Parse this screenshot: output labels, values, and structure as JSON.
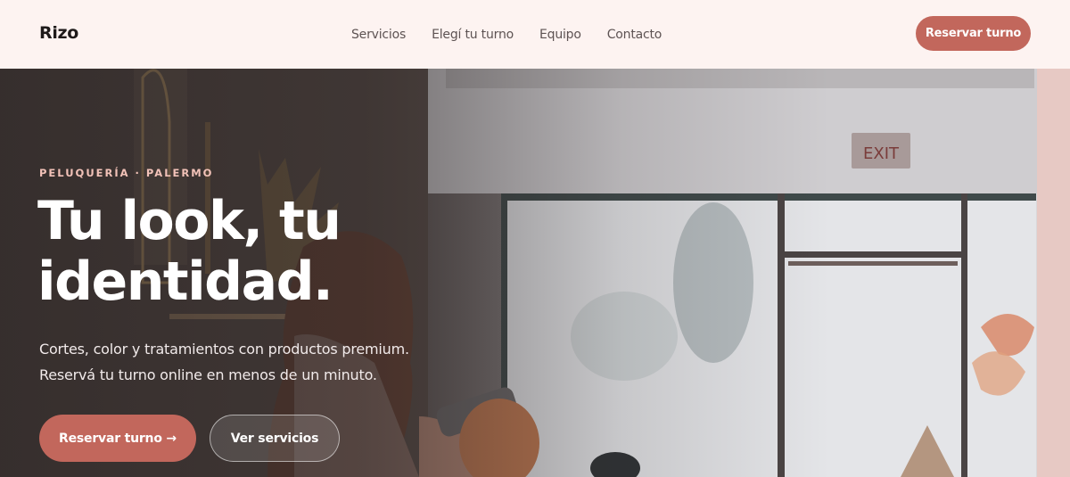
{
  "nav": {
    "brand": "Rizo",
    "links": [
      "Servicios",
      "Elegí tu turno",
      "Equipo",
      "Contacto"
    ],
    "cta": "Reservar turno"
  },
  "hero": {
    "eyebrow": "PELUQUERÍA · PALERMO",
    "headline_line1": "Tu look, tu",
    "headline_line2": "identidad.",
    "subtitle_line1": "Cortes, color y tratamientos con productos premium.",
    "subtitle_line2": "Reservá tu turno online en menos de un minuto.",
    "primary_button": "Reservar turno →",
    "secondary_button": "Ver servicios",
    "background_image": "salon-photo"
  },
  "colors": {
    "accent": "#c2675c",
    "nav_bg": "#fdf3f1",
    "eyebrow": "#f2c2b8"
  }
}
